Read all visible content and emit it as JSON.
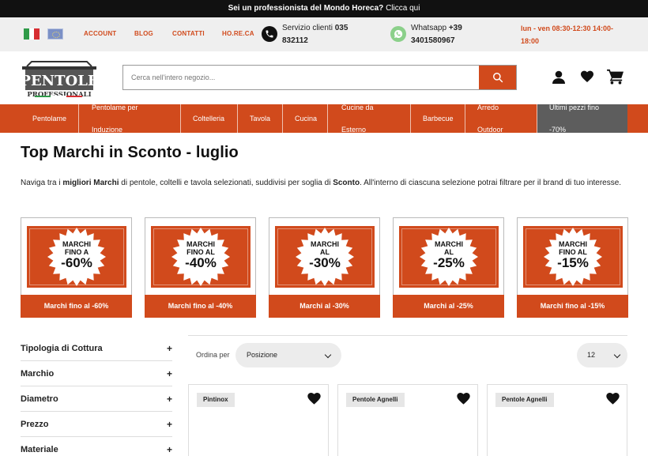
{
  "announcement": {
    "bold": "Sei un professionista del Mondo Horeca?",
    "link": "Clicca qui"
  },
  "infobar": {
    "links": [
      "ACCOUNT",
      "BLOG",
      "CONTATTI",
      "HO.RE.CA"
    ],
    "service_label": "Servizio clienti",
    "service_number_a": "035",
    "service_number_b": "832112",
    "whatsapp_label": "Whatsapp",
    "whatsapp_number_a": "+39",
    "whatsapp_number_b": "3401580967",
    "hours_a": "lun - ven 08:30-12:30 14:00-",
    "hours_b": "18:00"
  },
  "logo": {
    "line1": "PENTOLE",
    "line2": "PROFESSIONALI"
  },
  "search": {
    "placeholder": "Cerca nell'intero negozio..."
  },
  "nav": [
    {
      "l1": "Pentolame",
      "l2": ""
    },
    {
      "l1": "Pentolame per",
      "l2": "Induzione"
    },
    {
      "l1": "Coltelleria",
      "l2": ""
    },
    {
      "l1": "Tavola",
      "l2": ""
    },
    {
      "l1": "Cucina",
      "l2": ""
    },
    {
      "l1": "Cucine da",
      "l2": "Esterno"
    },
    {
      "l1": "Barbecue",
      "l2": ""
    },
    {
      "l1": "Arredo",
      "l2": "Outdoor"
    },
    {
      "l1": "Ultimi pezzi fino",
      "l2": "-70%"
    }
  ],
  "page": {
    "title": "Top Marchi in Sconto - luglio",
    "intro": {
      "t1": "Naviga tra i ",
      "b1": "migliori Marchi",
      "t2": " di pentole, coltelli e tavola selezionati, suddivisi per soglia di ",
      "b2": "Sconto",
      "t3": ". All'interno di ciascuna selezione potrai filtrare per il brand di tuo interesse."
    }
  },
  "discounts": [
    {
      "badge1": "MARCHI",
      "badge2": "FINO A",
      "badge_pct": "-60%",
      "button": "Marchi fino al -60%"
    },
    {
      "badge1": "MARCHI",
      "badge2": "FINO AL",
      "badge_pct": "-40%",
      "button": "Marchi fino al -40%"
    },
    {
      "badge1": "MARCHI",
      "badge2": "AL",
      "badge_pct": "-30%",
      "button": "Marchi al -30%"
    },
    {
      "badge1": "MARCHI",
      "badge2": "AL",
      "badge_pct": "-25%",
      "button": "Marchi al -25%"
    },
    {
      "badge1": "MARCHI",
      "badge2": "FINO AL",
      "badge_pct": "-15%",
      "button": "Marchi fino al -15%"
    }
  ],
  "filters": [
    "Tipologia di Cottura",
    "Marchio",
    "Diametro",
    "Prezzo",
    "Materiale"
  ],
  "toolbar": {
    "sort_label": "Ordina per",
    "sort_value": "Posizione",
    "per_page": "12"
  },
  "products": [
    {
      "brand": "Pintinox"
    },
    {
      "brand": "Pentole Agnelli"
    },
    {
      "brand": "Pentole Agnelli"
    }
  ],
  "colors": {
    "brand_orange": "#d14a1c",
    "dark_nav": "#5d5d5d",
    "topbar": "#111111"
  }
}
